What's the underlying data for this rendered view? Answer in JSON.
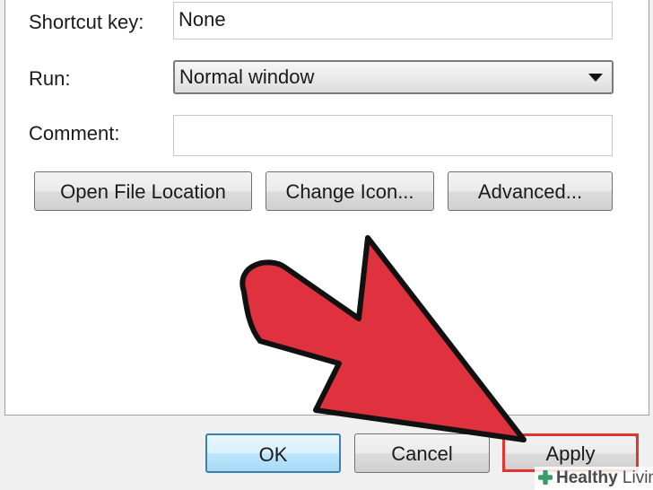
{
  "fields": {
    "shortcut_key": {
      "label": "Shortcut key:",
      "value": "None"
    },
    "run": {
      "label": "Run:",
      "value": "Normal window"
    },
    "comment": {
      "label": "Comment:",
      "value": ""
    }
  },
  "actions": {
    "open_file_location": "Open File Location",
    "change_icon": "Change Icon...",
    "advanced": "Advanced..."
  },
  "footer": {
    "ok": "OK",
    "cancel": "Cancel",
    "apply": "Apply"
  },
  "annotation": {
    "arrow_color": "#e0313f",
    "highlight_color": "#e03530"
  },
  "watermark": {
    "text_bold": "Healthy",
    "text_regular": "Living",
    "icon": "leaf-cross-icon",
    "icon_color": "#3a9b6a"
  }
}
